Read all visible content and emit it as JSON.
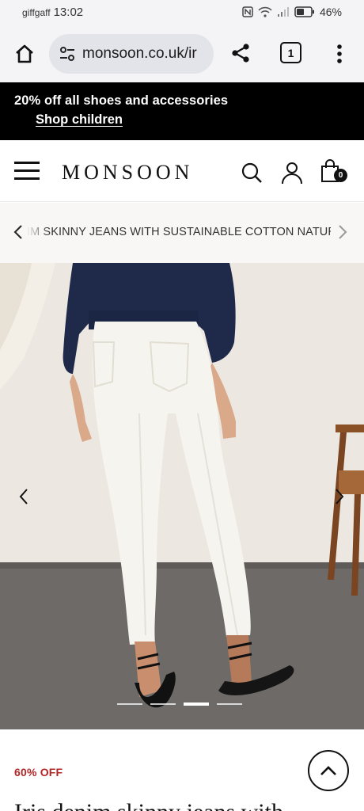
{
  "status_bar": {
    "carrier": "giffgaff",
    "time": "13:02",
    "battery": "46%",
    "icons": [
      "nfc-icon",
      "wifi-icon",
      "signal-icon",
      "battery-icon"
    ]
  },
  "browser": {
    "url": "monsoon.co.uk/ir",
    "tab_count": "1",
    "icons": [
      "home-icon",
      "site-info-icon",
      "share-icon",
      "tabs-icon",
      "more-vert-icon"
    ]
  },
  "promo": {
    "line1": "20% off all shoes and accessories",
    "line2": "Shop children"
  },
  "header": {
    "logo": "MONSOON",
    "bag_count": "0",
    "icons": [
      "menu-icon",
      "search-icon",
      "account-icon",
      "bag-icon"
    ]
  },
  "breadcrumb": {
    "text": "IM SKINNY JEANS WITH SUSTAINABLE COTTON NATURAL"
  },
  "gallery": {
    "image_count": 4,
    "active_index": 2
  },
  "product": {
    "discount_label": "60% OFF",
    "title": "Iris denim skinny jeans with"
  },
  "colors": {
    "promo_bg": "#000000",
    "discount_red": "#b32626",
    "browser_bg": "#f4f4f6",
    "breadcrumb_bg": "#f8f7f5"
  }
}
